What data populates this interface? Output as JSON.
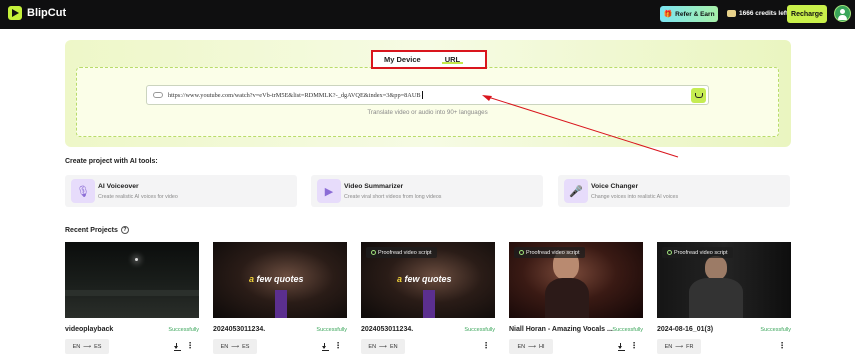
{
  "app": {
    "name": "BlipCut"
  },
  "header": {
    "refer_label": "Refer & Earn",
    "credits_label": "1666 credits left",
    "recharge_label": "Recharge"
  },
  "upload": {
    "tabs": [
      {
        "label": "My Device"
      },
      {
        "label": "URL"
      }
    ],
    "active_tab": "URL",
    "url_value": "https://www.youtube.com/watch?v=eVb-trM5E&list=RDMMLK?-_dgAVQE&index=3&pp=8AUB",
    "hint": "Translate video or audio into 90+ languages"
  },
  "tools": {
    "title": "Create project with AI tools:",
    "items": [
      {
        "name": "AI Voiceover",
        "desc": "Create realistic AI voices for video",
        "icon": "microphone-icon"
      },
      {
        "name": "Video Summarizer",
        "desc": "Create viral short videos from long videos",
        "icon": "video-summarizer-icon"
      },
      {
        "name": "Voice Changer",
        "desc": "Change voices into realistic AI voices",
        "icon": "voice-changer-icon"
      }
    ]
  },
  "recent": {
    "title": "Recent Projects",
    "projects": [
      {
        "name": "videoplayback",
        "status": "Successfully",
        "src": "EN",
        "dst": "ES",
        "badge": "",
        "caption": ""
      },
      {
        "name": "2024053011234.",
        "status": "Successfully",
        "src": "EN",
        "dst": "ES",
        "badge": "",
        "caption": "a few quotes"
      },
      {
        "name": "2024053011234.",
        "status": "Successfully",
        "src": "EN",
        "dst": "EN",
        "badge": "Proofread video script",
        "caption": "a few quotes"
      },
      {
        "name": "Niall Horan - Amazing Vocals ...",
        "status": "Successfully",
        "src": "EN",
        "dst": "HI",
        "badge": "Proofread video script",
        "caption": ""
      },
      {
        "name": "2024-08-16_01(3)",
        "status": "Successfully",
        "src": "EN",
        "dst": "FR",
        "badge": "Proofread video script",
        "caption": ""
      }
    ]
  },
  "colors": {
    "accent": "#c5f13a",
    "highlight_box": "#d9151d",
    "status": "#3aa55a"
  }
}
